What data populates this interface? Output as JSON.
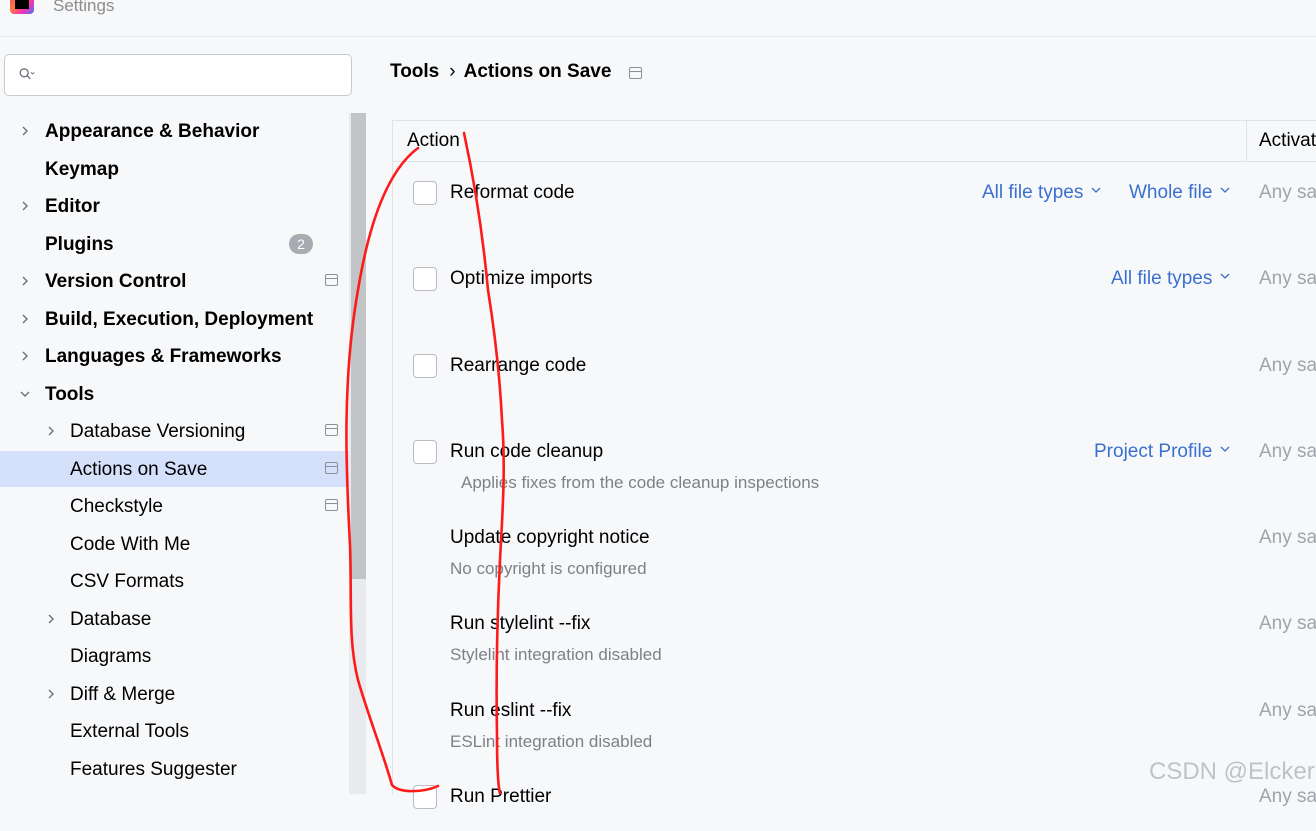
{
  "window": {
    "title": "Settings"
  },
  "sidebar": {
    "search": {
      "value": "",
      "placeholder": ""
    },
    "items": [
      {
        "label": "Appearance & Behavior",
        "bold": true,
        "expandable": true,
        "expanded": false
      },
      {
        "label": "Keymap",
        "bold": true,
        "expandable": false
      },
      {
        "label": "Editor",
        "bold": true,
        "expandable": true,
        "expanded": false
      },
      {
        "label": "Plugins",
        "bold": true,
        "expandable": false,
        "badge": "2"
      },
      {
        "label": "Version Control",
        "bold": true,
        "expandable": true,
        "expanded": false,
        "project_icon": true
      },
      {
        "label": "Build, Execution, Deployment",
        "bold": true,
        "expandable": true,
        "expanded": false
      },
      {
        "label": "Languages & Frameworks",
        "bold": true,
        "expandable": true,
        "expanded": false
      },
      {
        "label": "Tools",
        "bold": true,
        "expandable": true,
        "expanded": true
      },
      {
        "label": "Database Versioning",
        "bold": false,
        "expandable": true,
        "expanded": false,
        "project_icon": true
      },
      {
        "label": "Actions on Save",
        "bold": false,
        "expandable": false,
        "selected": true,
        "project_icon": true
      },
      {
        "label": "Checkstyle",
        "bold": false,
        "expandable": false,
        "project_icon": true
      },
      {
        "label": "Code With Me",
        "bold": false,
        "expandable": false
      },
      {
        "label": "CSV Formats",
        "bold": false,
        "expandable": false
      },
      {
        "label": "Database",
        "bold": false,
        "expandable": true,
        "expanded": false
      },
      {
        "label": "Diagrams",
        "bold": false,
        "expandable": false
      },
      {
        "label": "Diff & Merge",
        "bold": false,
        "expandable": true,
        "expanded": false
      },
      {
        "label": "External Tools",
        "bold": false,
        "expandable": false
      },
      {
        "label": "Features Suggester",
        "bold": false,
        "expandable": false
      }
    ]
  },
  "main": {
    "breadcrumb": {
      "parent": "Tools",
      "separator": "›",
      "current": "Actions on Save"
    },
    "table": {
      "columns": {
        "action": "Action",
        "activation": "Activat"
      },
      "rows": [
        {
          "label": "Reformat code",
          "checkbox": true,
          "checked": false,
          "dropdowns": [
            "All file types",
            "Whole file"
          ],
          "activation": "Any sa"
        },
        {
          "label": "Optimize imports",
          "checkbox": true,
          "checked": false,
          "dropdowns": [
            "All file types"
          ],
          "activation": "Any sa"
        },
        {
          "label": "Rearrange code",
          "checkbox": true,
          "checked": false,
          "dropdowns": [],
          "activation": "Any sa"
        },
        {
          "label": "Run code cleanup",
          "checkbox": true,
          "checked": false,
          "dropdowns": [
            "Project Profile"
          ],
          "description": "Applies fixes from the code cleanup inspections",
          "activation": "Any sa"
        },
        {
          "label": "Update copyright notice",
          "checkbox": false,
          "description": "No copyright is configured",
          "activation": "Any sa"
        },
        {
          "label": "Run stylelint --fix",
          "checkbox": false,
          "description": "Stylelint integration disabled",
          "activation": "Any sa"
        },
        {
          "label": "Run eslint --fix",
          "checkbox": false,
          "description": "ESLint integration disabled",
          "activation": "Any sa"
        },
        {
          "label": "Run Prettier",
          "checkbox": true,
          "checked": false,
          "activation": "Any sa"
        }
      ]
    }
  },
  "watermark": "CSDN @Elcker",
  "colors": {
    "link_blue": "#3b6fd0",
    "selection": "#d5e1fb",
    "annotation_red": "#ff1a1a"
  }
}
